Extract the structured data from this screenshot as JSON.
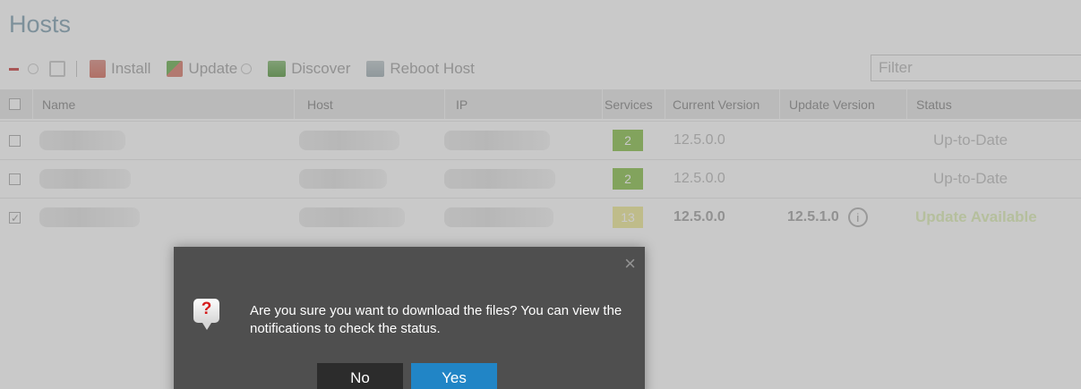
{
  "page": {
    "title": "Hosts"
  },
  "toolbar": {
    "install_label": "Install",
    "update_label": "Update",
    "discover_label": "Discover",
    "reboot_label": "Reboot Host",
    "filter_placeholder": "Filter"
  },
  "table": {
    "columns": [
      "Name",
      "Host",
      "IP",
      "Services",
      "Current Version",
      "Update Version",
      "Status"
    ],
    "rows": [
      {
        "services": "2",
        "services_color": "#a6cf77",
        "current_version": "12.5.0.0",
        "update_version": "",
        "status": "Up-to-Date",
        "checked": false
      },
      {
        "services": "2",
        "services_color": "#a6cf77",
        "current_version": "12.5.0.0",
        "update_version": "",
        "status": "Up-to-Date",
        "checked": false
      },
      {
        "services": "13",
        "services_color": "#f3efb0",
        "current_version": "12.5.0.0",
        "update_version": "12.5.1.0",
        "status": "Update Available",
        "checked": true
      }
    ]
  },
  "dialog": {
    "message": "Are you sure you want to download the files? You can view the notifications to check the status.",
    "no_label": "No",
    "yes_label": "Yes",
    "close_icon": "×",
    "question_mark": "?"
  }
}
